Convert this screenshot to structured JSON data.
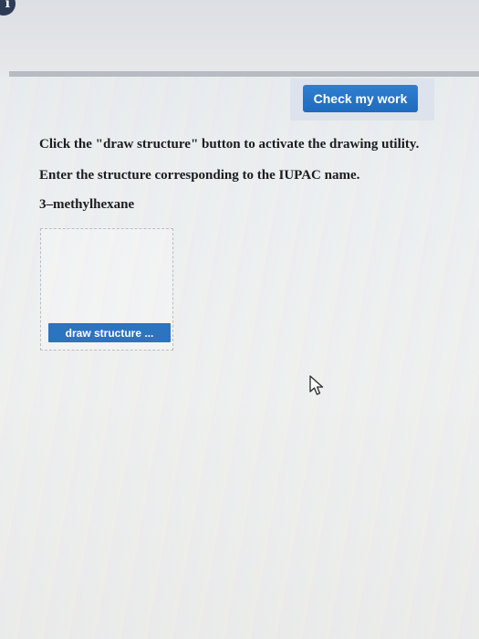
{
  "header": {
    "info_glyph": "i"
  },
  "toolbar": {
    "check_my_work_label": "Check my work"
  },
  "question": {
    "instruction_1": "Click the \"draw structure\" button to activate the drawing utility.",
    "instruction_2": "Enter the structure corresponding to the IUPAC name.",
    "compound_name": "3–methylhexane"
  },
  "drawing": {
    "button_label": "draw structure ..."
  },
  "icons": {
    "info": "info-icon",
    "cursor": "mouse-pointer-icon"
  },
  "colors": {
    "accent_button": "#2c73c0",
    "check_button": "#2475c8",
    "info_icon_bg": "#2e3b55"
  }
}
